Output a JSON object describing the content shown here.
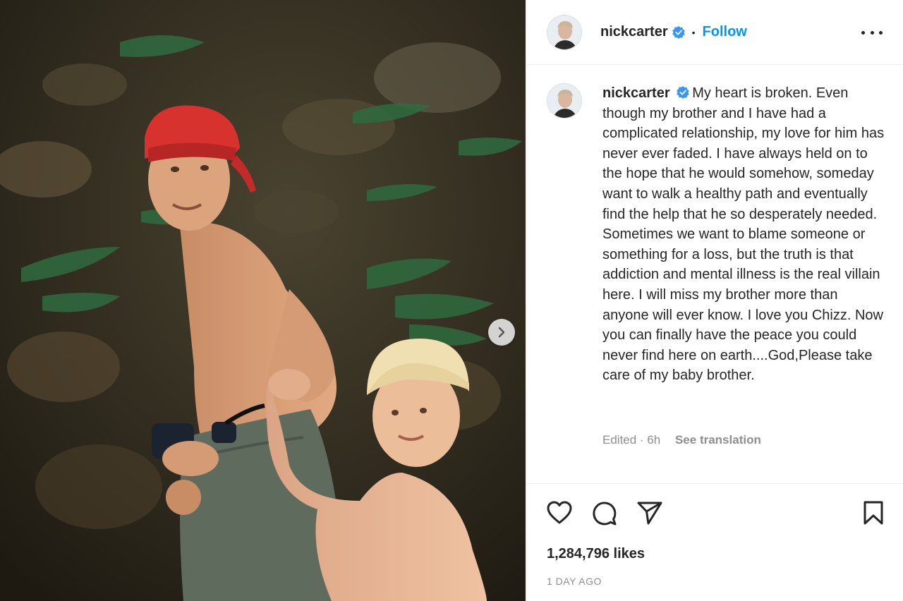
{
  "post": {
    "username": "nickcarter",
    "follow_label": "Follow",
    "dot": "•",
    "caption": "My heart is broken. Even though my brother and I have had a complicated relationship, my love for him has never ever faded. I have always held on to the hope that he would somehow, someday want to walk a healthy path and eventually find the help that he so desperately needed. Sometimes we want to blame someone or something for a loss, but the truth is that addiction and mental illness is the real villain here. I will miss my brother more than anyone will ever know. I love you Chizz. Now you can finally have the peace you could never find here on earth....God,Please take care of my baby brother.",
    "edited_label": "Edited · 6h",
    "see_translation_label": "See translation",
    "likes_label": "1,284,796 likes",
    "time_label": "1 DAY AGO"
  },
  "icons": {
    "verified": "verified-badge-icon",
    "more": "more-options-icon",
    "next": "chevron-right-icon",
    "like": "heart-icon",
    "comment": "comment-icon",
    "share": "paper-plane-icon",
    "save": "bookmark-icon"
  },
  "colors": {
    "accent": "#0095f6",
    "verified": "#3897f0",
    "text": "#262626",
    "muted": "#8e8e8e"
  }
}
